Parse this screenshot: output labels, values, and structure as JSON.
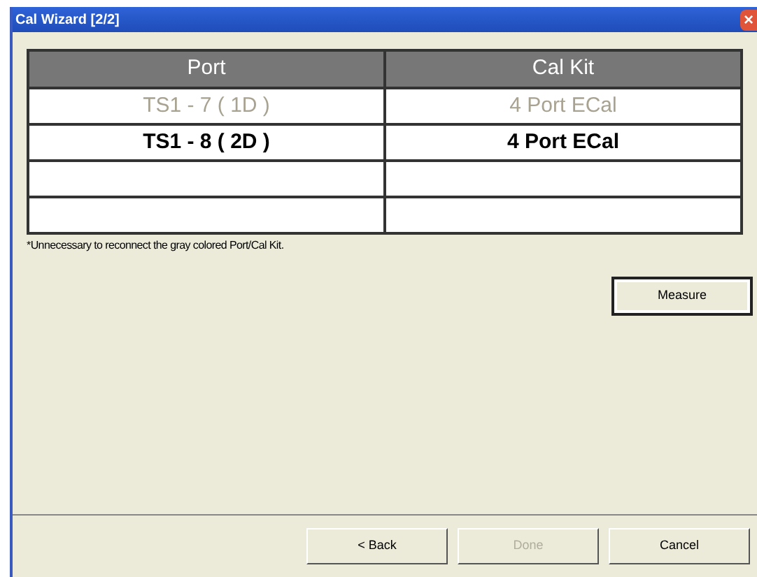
{
  "window": {
    "title": "Cal Wizard [2/2]",
    "close": "×"
  },
  "table": {
    "columns": [
      "Port",
      "Cal Kit"
    ],
    "rows": [
      {
        "port": "TS1 - 7 ( 1D )",
        "cal_kit": "4 Port ECal",
        "disabled": true
      },
      {
        "port": "TS1 - 8 ( 2D )",
        "cal_kit": "4 Port ECal",
        "disabled": false
      }
    ]
  },
  "note": "*Unnecessary to reconnect the gray colored Port/Cal Kit.",
  "measure_button": {
    "label": "Measure",
    "default": true
  },
  "buttons": [
    {
      "label": "< Back",
      "disabled": false
    },
    {
      "label": "Done",
      "disabled": true
    },
    {
      "label": "Cancel",
      "disabled": false
    }
  ]
}
